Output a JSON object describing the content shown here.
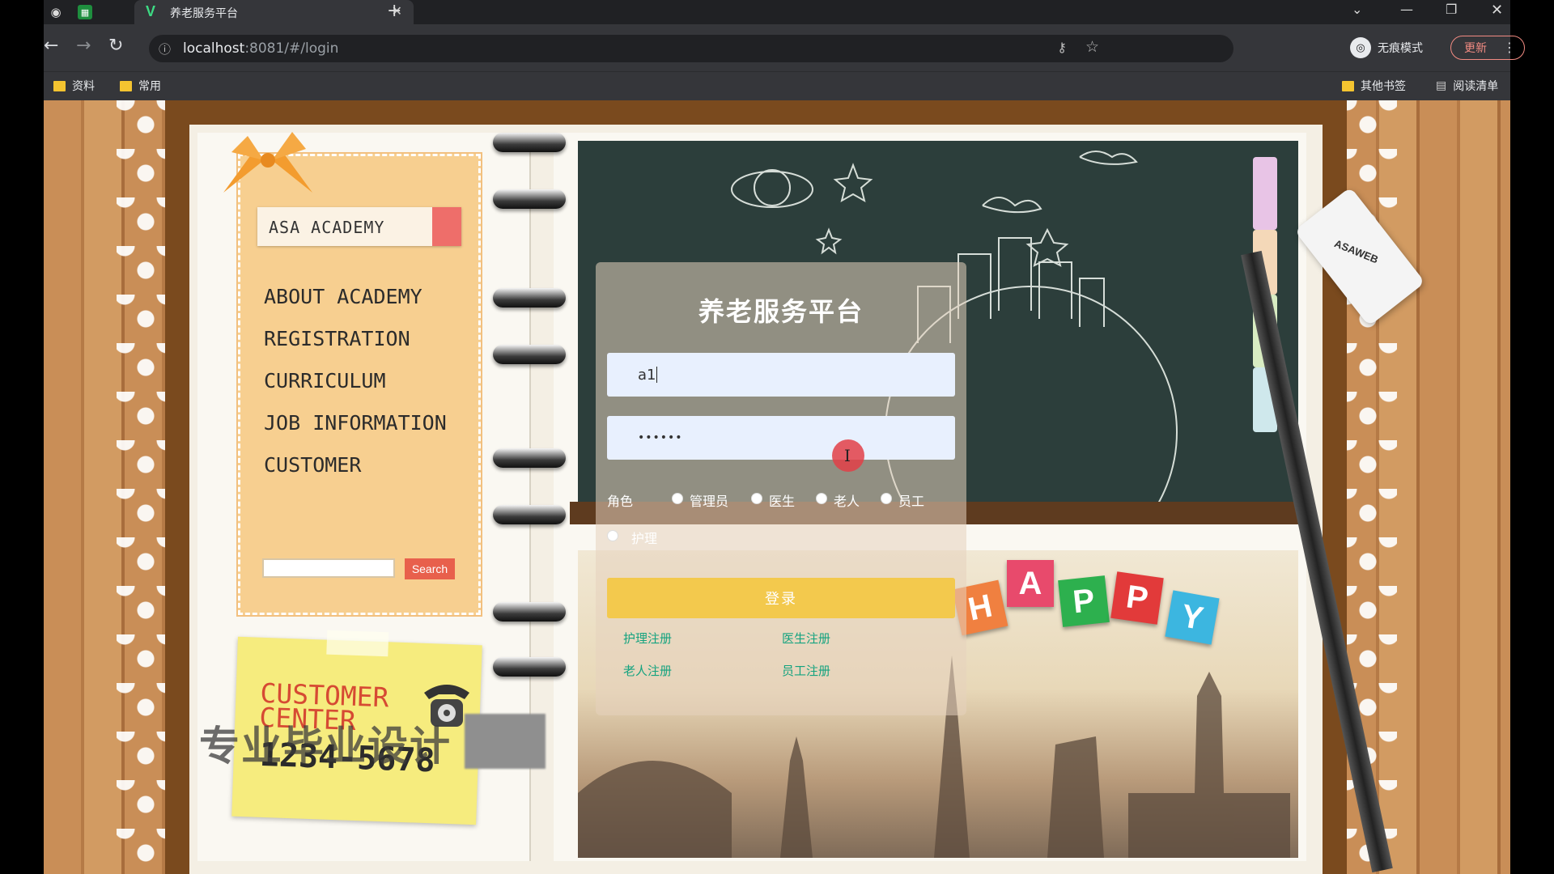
{
  "browser": {
    "tab_title": "养老服务平台",
    "url_host": "localhost",
    "url_rest": ":8081/#/login",
    "incognito_label": "无痕模式",
    "update_label": "更新",
    "bookmarks": [
      "资料",
      "常用"
    ],
    "other_bookmarks": "其他书签",
    "reading_list": "阅读清单"
  },
  "notebook": {
    "academy_tag": "ASA ACADEMY",
    "menu": [
      "ABOUT ACADEMY",
      "REGISTRATION",
      "CURRICULUM",
      "JOB INFORMATION",
      "CUSTOMER"
    ],
    "search_label": "Search",
    "sticky_title": "CUSTOMER CENTER",
    "sticky_phone": "1234-5678",
    "eraser_brand": "ASAWEB",
    "happy_letters": [
      "H",
      "A",
      "P",
      "P",
      "Y"
    ],
    "watermark": "专业毕业设计"
  },
  "login": {
    "title": "养老服务平台",
    "username_value": "a1",
    "password_value": "••••••",
    "role_label": "角色",
    "roles": [
      "管理员",
      "医生",
      "老人",
      "员工",
      "护理"
    ],
    "login_button": "登录",
    "links": [
      "护理注册",
      "医生注册",
      "老人注册",
      "员工注册"
    ]
  }
}
